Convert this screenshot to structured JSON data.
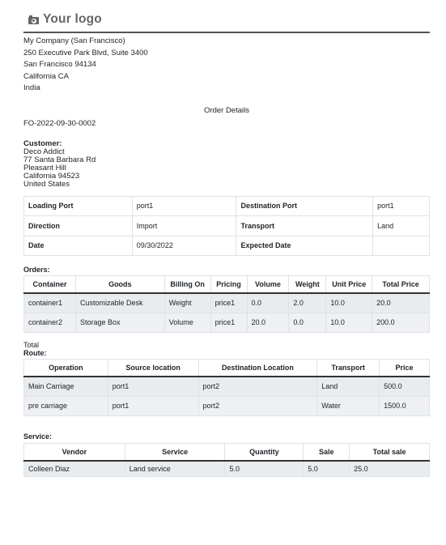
{
  "header": {
    "logo_text": "Your logo",
    "logo_icon": "camera-icon"
  },
  "company": {
    "lines": [
      "My Company (San Francisco)",
      "250 Executive Park Blvd, Suite 3400",
      "San Francisco 94134",
      "California CA",
      "India"
    ]
  },
  "document": {
    "title": "Order Details",
    "reference": "FO-2022-09-30-0002"
  },
  "customer": {
    "label": "Customer:",
    "lines": [
      "Deco Addict",
      "77 Santa Barbara Rd",
      "Pleasant Hill",
      "California 94523",
      "United States"
    ]
  },
  "info": {
    "rows": [
      {
        "k1": "Loading Port",
        "v1": "port1",
        "k2": "Destination Port",
        "v2": "port1"
      },
      {
        "k1": "Direction",
        "v1": "Import",
        "k2": "Transport",
        "v2": "Land"
      },
      {
        "k1": "Date",
        "v1": "09/30/2022",
        "k2": "Expected Date",
        "v2": ""
      }
    ]
  },
  "orders": {
    "label": "Orders:",
    "columns": [
      "Container",
      "Goods",
      "Billing On",
      "Pricing",
      "Volume",
      "Weight",
      "Unit Price",
      "Total Price"
    ],
    "rows": [
      [
        "container1",
        "Customizable Desk",
        "Weight",
        "price1",
        "0.0",
        "2.0",
        "10.0",
        "20.0"
      ],
      [
        "container2",
        "Storage Box",
        "Volume",
        "price1",
        "20.0",
        "0.0",
        "10.0",
        "200.0"
      ]
    ],
    "total_label": "Total"
  },
  "route": {
    "label": "Route:",
    "columns": [
      "Operation",
      "Source location",
      "Destination Location",
      "Transport",
      "Price"
    ],
    "rows": [
      [
        "Main Carriage",
        "port1",
        "port2",
        "Land",
        "500.0"
      ],
      [
        "pre carriage",
        "port1",
        "port2",
        "Water",
        "1500.0"
      ]
    ]
  },
  "service": {
    "label": "Service:",
    "columns": [
      "Vendor",
      "Service",
      "Quantity",
      "Sale",
      "Total sale"
    ],
    "rows": [
      [
        "Colleen Diaz",
        "Land service",
        "5.0",
        "5.0",
        "25.0"
      ]
    ]
  },
  "colors": {
    "row_bg": "#e9ecef",
    "border": "#dee2e6",
    "header_rule": "#555555",
    "logo": "#666666"
  }
}
